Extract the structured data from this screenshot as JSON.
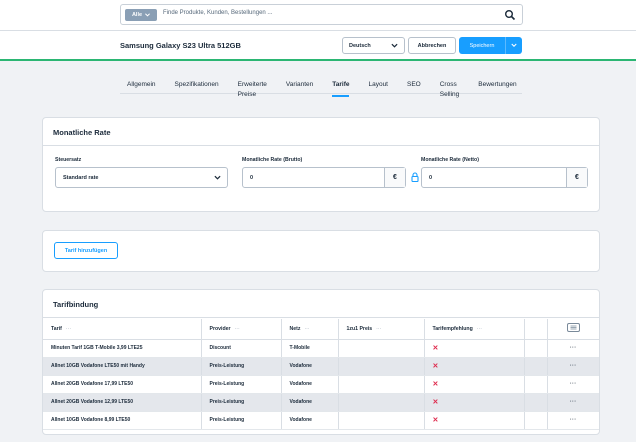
{
  "search": {
    "scope_label": "Alle",
    "placeholder": "Finde Produkte, Kunden, Bestellungen ..."
  },
  "header": {
    "product_title": "Samsung Galaxy S23 Ultra 512GB",
    "language": "Deutsch",
    "cancel_label": "Abbrechen",
    "save_label": "Speichern"
  },
  "tabs": [
    {
      "label": "Allgemein",
      "active": false
    },
    {
      "label": "Spezifikationen",
      "active": false
    },
    {
      "label": "Erweiterte Preise",
      "active": false
    },
    {
      "label": "Varianten",
      "active": false
    },
    {
      "label": "Tarife",
      "active": true
    },
    {
      "label": "Layout",
      "active": false
    },
    {
      "label": "SEO",
      "active": false
    },
    {
      "label": "Cross Selling",
      "active": false
    },
    {
      "label": "Bewertungen",
      "active": false
    }
  ],
  "rate_card": {
    "title": "Monatliche Rate",
    "tax_label": "Steuersatz",
    "tax_value": "Standard rate",
    "gross_label": "Monatliche Rate (Brutto)",
    "gross_value": "0",
    "net_label": "Monatliche Rate (Netto)",
    "net_value": "0",
    "currency": "€"
  },
  "add_card": {
    "button_label": "Tarif hinzufügen"
  },
  "binding": {
    "title": "Tarifbindung",
    "columns": [
      "Tarif",
      "Provider",
      "Netz",
      "1zu1 Preis",
      "Tarifempfehlung"
    ],
    "rows": [
      {
        "tarif": "Minuten Tarif 1GB T-Mobile 3,99 LTE25",
        "provider": "Discount",
        "netz": "T-Mobile",
        "preis": "",
        "empfehlung": "✕"
      },
      {
        "tarif": "Allnet 10GB Vodafone LTE50 mit Handy",
        "provider": "Preis-Leistung",
        "netz": "Vodafone",
        "preis": "",
        "empfehlung": "✕"
      },
      {
        "tarif": "Allnet 20GB Vodafone 17,99 LTE50",
        "provider": "Preis-Leistung",
        "netz": "Vodafone",
        "preis": "",
        "empfehlung": "✕"
      },
      {
        "tarif": "Allnet 20GB Vodafone 12,99 LTE50",
        "provider": "Preis-Leistung",
        "netz": "Vodafone",
        "preis": "",
        "empfehlung": "✕"
      },
      {
        "tarif": "Allnet 10GB Vodafone 8,99 LTE50",
        "provider": "Preis-Leistung",
        "netz": "Vodafone",
        "preis": "",
        "empfehlung": "✕"
      }
    ],
    "row_action": "···"
  },
  "colors": {
    "accent": "#189eff",
    "success_border": "#2bb673",
    "danger": "#de294c"
  }
}
